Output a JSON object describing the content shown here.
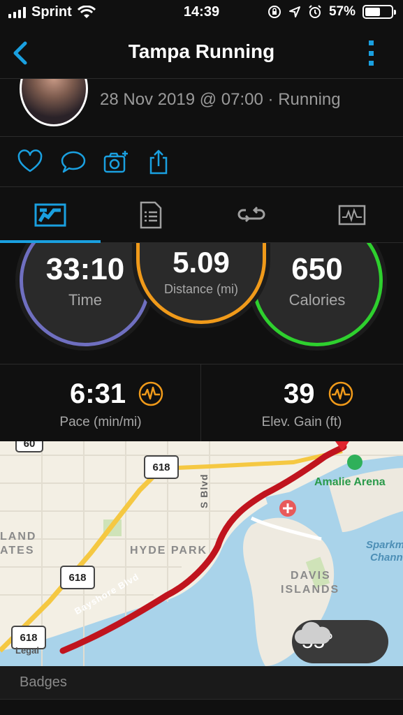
{
  "status_bar": {
    "carrier": "Sprint",
    "time": "14:39",
    "battery_percent": "57%",
    "battery_level": 0.57,
    "icons": [
      "signal-icon",
      "wifi-icon",
      "orientation-lock-icon",
      "location-icon",
      "alarm-icon",
      "battery-icon"
    ]
  },
  "nav": {
    "title": "Tampa Running",
    "back_icon": "chevron-left-icon",
    "more_icon": "more-vertical-icon"
  },
  "activity": {
    "meta": "28 Nov 2019 @ 07:00 · Running"
  },
  "actions": [
    "heart-icon",
    "comment-icon",
    "add-photo-icon",
    "share-icon"
  ],
  "tabs": [
    {
      "name": "summary-tab",
      "icon": "summary-icon",
      "active": true
    },
    {
      "name": "details-tab",
      "icon": "document-icon",
      "active": false
    },
    {
      "name": "laps-tab",
      "icon": "repeat-icon",
      "active": false
    },
    {
      "name": "charts-tab",
      "icon": "chart-icon",
      "active": false
    }
  ],
  "stats": {
    "time": {
      "value": "33:10",
      "label": "Time",
      "color": "#6f6fc0"
    },
    "distance": {
      "value": "5.09",
      "label": "Distance (mi)",
      "color": "#f09a1a"
    },
    "calories": {
      "value": "650",
      "label": "Calories",
      "color": "#2ed02e"
    },
    "pace": {
      "value": "6:31",
      "label": "Pace (min/mi)"
    },
    "elev_gain": {
      "value": "39",
      "label": "Elev. Gain (ft)"
    }
  },
  "map": {
    "labels": {
      "amalie": "Amalie Arena",
      "hyde_park": "HYDE PARK",
      "davis1": "DAVIS",
      "davis2": "ISLANDS",
      "land1": "LAND",
      "land2": "ATES",
      "sblvd": "S Blvd",
      "bayshore": "Bayshore Blvd",
      "sparkm1": "Sparkm",
      "sparkm2": "Chann",
      "legal": "Legal"
    },
    "shields": [
      "60",
      "618",
      "618",
      "618"
    ],
    "route_color": "#c0141e",
    "water_color": "#a9d3ea"
  },
  "weather": {
    "temp": "55°",
    "icon": "cloud-icon"
  },
  "badges": {
    "title": "Badges"
  }
}
